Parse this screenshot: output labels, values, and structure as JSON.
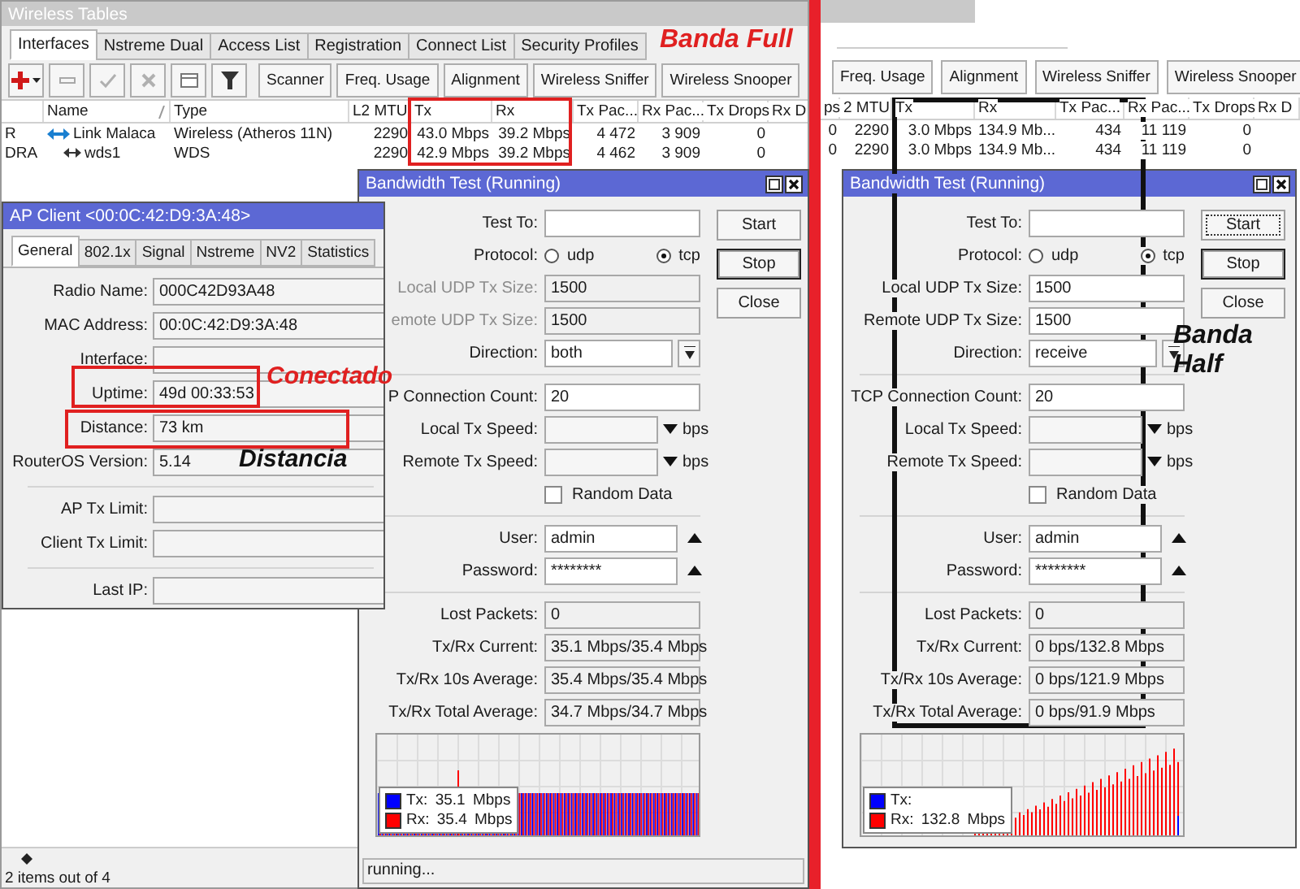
{
  "left": {
    "wireless_tables": {
      "title": "Wireless Tables",
      "tabs": [
        {
          "label": "Interfaces",
          "selected": true
        },
        {
          "label": "Nstreme Dual",
          "selected": false
        },
        {
          "label": "Access List",
          "selected": false
        },
        {
          "label": "Registration",
          "selected": false
        },
        {
          "label": "Connect List",
          "selected": false
        },
        {
          "label": "Security Profiles",
          "selected": false
        }
      ],
      "toolbar": [
        {
          "kind": "add"
        },
        {
          "kind": "remove"
        },
        {
          "kind": "enable"
        },
        {
          "kind": "disable"
        },
        {
          "kind": "comment"
        },
        {
          "kind": "filter"
        },
        {
          "kind": "text",
          "label": "Scanner"
        },
        {
          "kind": "text",
          "label": "Freq. Usage"
        },
        {
          "kind": "text",
          "label": "Alignment"
        },
        {
          "kind": "text",
          "label": "Wireless Sniffer"
        },
        {
          "kind": "text",
          "label": "Wireless Snooper"
        }
      ],
      "columns": [
        "Name",
        "Type",
        "L2 MTU",
        "Tx",
        "Rx",
        "Tx Pac...",
        "Rx Pac...",
        "Tx Drops",
        "Rx D"
      ],
      "rows": [
        {
          "flags": "R",
          "kind": "wireless",
          "cells": [
            "Link Malaca",
            "Wireless (Atheros 11N)",
            "2290",
            "43.0 Mbps",
            "39.2 Mbps",
            "4 472",
            "3 909",
            "0"
          ]
        },
        {
          "flags": "DRA",
          "kind": "wds",
          "cells": [
            "wds1",
            "WDS",
            "2290",
            "42.9 Mbps",
            "39.2 Mbps",
            "4 462",
            "3 909",
            "0"
          ]
        }
      ],
      "status": "2 items out of 4"
    },
    "ap_client": {
      "title": "AP Client <00:0C:42:D9:3A:48>",
      "tabs": [
        {
          "label": "General",
          "selected": true
        },
        {
          "label": "802.1x",
          "selected": false
        },
        {
          "label": "Signal",
          "selected": false
        },
        {
          "label": "Nstreme",
          "selected": false
        },
        {
          "label": "NV2",
          "selected": false
        },
        {
          "label": "Statistics",
          "selected": false
        }
      ],
      "groups": [
        {
          "fields": [
            {
              "label": "Radio Name:",
              "value": "000C42D93A48"
            },
            {
              "label": "MAC Address:",
              "value": "00:0C:42:D9:3A:48"
            },
            {
              "label": "Interface:"
            },
            {
              "label": "Uptime:",
              "value": "49d 00:33:53"
            },
            {
              "label": "Distance:",
              "value": "73 km"
            },
            {
              "label": "RouterOS Version:",
              "value": "5.14"
            }
          ]
        },
        {
          "fields": [
            {
              "label": "AP Tx Limit:"
            },
            {
              "label": "Client Tx Limit:"
            }
          ]
        },
        {
          "fields": [
            {
              "label": "Last IP:"
            }
          ]
        }
      ]
    },
    "bandwidth_test": {
      "title": "Bandwidth Test (Running)",
      "groups": [
        {
          "rows": [
            {
              "kind": "text",
              "label": "Test To:",
              "disabled": false
            },
            {
              "kind": "radio",
              "label": "Protocol:",
              "options": [
                {
                  "label": "udp",
                  "selected": false
                },
                {
                  "label": "tcp",
                  "selected": true
                }
              ]
            },
            {
              "kind": "text",
              "label": "Local UDP Tx Size:",
              "value": "1500",
              "disabled": true
            },
            {
              "kind": "text",
              "label": "emote UDP Tx Size:",
              "value": "1500",
              "disabled": true
            },
            {
              "kind": "select",
              "label": "Direction:",
              "value": "both"
            }
          ]
        },
        {
          "rows": [
            {
              "kind": "text",
              "label": "P Connection Count:",
              "value": "20",
              "disabled": false
            },
            {
              "kind": "speed",
              "label": "Local Tx Speed:",
              "unit": "bps"
            },
            {
              "kind": "speed",
              "label": "Remote Tx Speed:",
              "unit": "bps"
            },
            {
              "kind": "check",
              "label": "Random Data",
              "checked": false
            }
          ]
        },
        {
          "rows": [
            {
              "kind": "combo",
              "label": "User:",
              "value": "admin"
            },
            {
              "kind": "combo",
              "label": "Password:",
              "value": "********"
            }
          ]
        },
        {
          "rows": [
            {
              "kind": "output",
              "label": "Lost Packets:",
              "value": "0"
            },
            {
              "kind": "output",
              "label": "Tx/Rx Current:",
              "value": "35.1 Mbps/35.4 Mbps"
            },
            {
              "kind": "output",
              "label": "Tx/Rx 10s Average:",
              "value": "35.4 Mbps/35.4 Mbps"
            },
            {
              "kind": "output",
              "label": "Tx/Rx Total Average:",
              "value": "34.7 Mbps/34.7 Mbps"
            }
          ]
        }
      ],
      "buttons": [
        {
          "label": "Start",
          "default": false,
          "focused": false
        },
        {
          "label": "Stop",
          "default": true,
          "focused": false
        },
        {
          "label": "Close",
          "default": false,
          "focused": false
        }
      ],
      "graph": {
        "kind": "steady",
        "legend": [
          {
            "text": "Tx: 35.1 Mbps",
            "color": "#0000ff"
          },
          {
            "text": "Rx: 35.4 Mbps",
            "color": "#ff0000"
          }
        ]
      },
      "status": "running..."
    }
  },
  "right": {
    "wireless_tables": {
      "toolbar": [
        {
          "kind": "text",
          "label": "Freq. Usage"
        },
        {
          "kind": "text",
          "label": "Alignment"
        },
        {
          "kind": "text",
          "label": "Wireless Sniffer"
        },
        {
          "kind": "text",
          "label": "Wireless Snooper"
        }
      ],
      "columns": [
        "ps",
        "2 MTU",
        "Tx",
        "Rx",
        "Tx Pac...",
        "Rx Pac...",
        "Tx Drops",
        "Rx D"
      ],
      "rows": [
        {
          "cells": [
            "0",
            "2290",
            "3.0 Mbps",
            "134.9 Mb...",
            "434",
            "11 119",
            "0"
          ]
        },
        {
          "cells": [
            "0",
            "2290",
            "3.0 Mbps",
            "134.9 Mb...",
            "434",
            "11 119",
            "0"
          ]
        }
      ]
    },
    "bandwidth_test": {
      "title": "Bandwidth Test (Running)",
      "groups": [
        {
          "rows": [
            {
              "kind": "text",
              "label": "Test To:",
              "disabled": false
            },
            {
              "kind": "radio",
              "label": "Protocol:",
              "options": [
                {
                  "label": "udp",
                  "selected": false
                },
                {
                  "label": "tcp",
                  "selected": true
                }
              ]
            },
            {
              "kind": "text",
              "label": "Local UDP Tx Size:",
              "value": "1500",
              "disabled": false
            },
            {
              "kind": "text",
              "label": "Remote UDP Tx Size:",
              "value": "1500",
              "disabled": false
            },
            {
              "kind": "select",
              "label": "Direction:",
              "value": "receive"
            }
          ]
        },
        {
          "rows": [
            {
              "kind": "text",
              "label": "TCP Connection Count:",
              "value": "20",
              "disabled": false
            },
            {
              "kind": "speed",
              "label": "Local Tx Speed:",
              "unit": "bps"
            },
            {
              "kind": "speed",
              "label": "Remote Tx Speed:",
              "unit": "bps"
            },
            {
              "kind": "check",
              "label": "Random Data",
              "checked": false
            }
          ]
        },
        {
          "rows": [
            {
              "kind": "combo",
              "label": "User:",
              "value": "admin"
            },
            {
              "kind": "combo",
              "label": "Password:",
              "value": "********"
            }
          ]
        },
        {
          "rows": [
            {
              "kind": "output",
              "label": "Lost Packets:",
              "value": "0"
            },
            {
              "kind": "output",
              "label": "Tx/Rx Current:",
              "value": "0 bps/132.8 Mbps"
            },
            {
              "kind": "output",
              "label": "Tx/Rx 10s Average:",
              "value": "0 bps/121.9 Mbps"
            },
            {
              "kind": "output",
              "label": "Tx/Rx Total Average:",
              "value": "0 bps/91.9 Mbps"
            }
          ]
        }
      ],
      "buttons": [
        {
          "label": "Start",
          "default": false,
          "focused": true
        },
        {
          "label": "Stop",
          "default": true,
          "focused": false
        },
        {
          "label": "Close",
          "default": false,
          "focused": false
        }
      ],
      "graph": {
        "kind": "rising",
        "legend": [
          {
            "text": "Tx:",
            "color": "#0000ff"
          },
          {
            "text": "Rx: 132.8 Mbps",
            "color": "#ff0000"
          }
        ]
      }
    }
  },
  "annotations": [
    {
      "text": "Banda Full",
      "color": "#e02020"
    },
    {
      "text": "Conectado",
      "color": "#e02020"
    },
    {
      "text": "Distancia",
      "color": "#111111"
    },
    {
      "text": "Banda Half",
      "color": "#111111"
    }
  ],
  "highlights": [
    {
      "color": "#e02020"
    },
    {
      "color": "#e02020"
    },
    {
      "color": "#e02020"
    },
    {
      "color": "#111111"
    }
  ]
}
